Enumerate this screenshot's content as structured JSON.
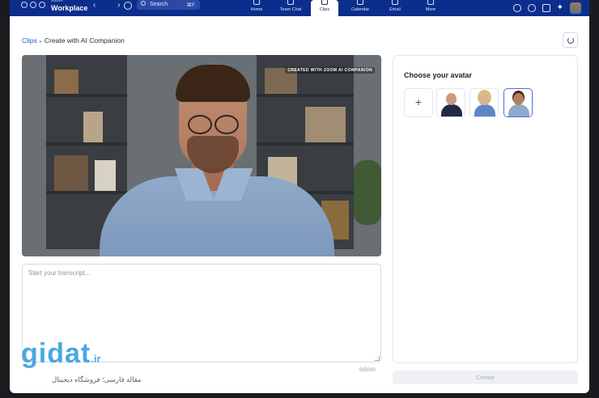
{
  "topbar": {
    "brand_small": "zoom",
    "brand_name": "Workplace",
    "nav_arrows": "‹ ›",
    "search_label": "Search",
    "search_shortcut": "⌘F",
    "tabs": [
      {
        "label": "Home"
      },
      {
        "label": "Team Chat"
      },
      {
        "label": "Clips"
      },
      {
        "label": "Calendar"
      },
      {
        "label": "Email"
      },
      {
        "label": "More"
      }
    ],
    "active_tab": "Clips",
    "accent_color": "#0b2e8c"
  },
  "breadcrumb": {
    "parent": "Clips",
    "separator": "▸",
    "current": "Create with AI Companion"
  },
  "video": {
    "watermark": "CREATED WITH ZOOM AI COMPANION"
  },
  "transcript": {
    "placeholder": "Start your transcript...",
    "value": "",
    "counter": "0/5000"
  },
  "avatar_panel": {
    "title": "Choose your avatar",
    "add_symbol": "+",
    "avatars": [
      {
        "label": "avatar-1"
      },
      {
        "label": "avatar-2"
      },
      {
        "label": "avatar-3"
      }
    ],
    "selected_index": 2,
    "selected_color": "#4a6fd9"
  },
  "create_button": {
    "label": "Create"
  },
  "site_logo": {
    "main": "gidat",
    "tld": ".ir",
    "subtitle": "مقاله فارسی؛ فروشگاه دیجیتال"
  }
}
